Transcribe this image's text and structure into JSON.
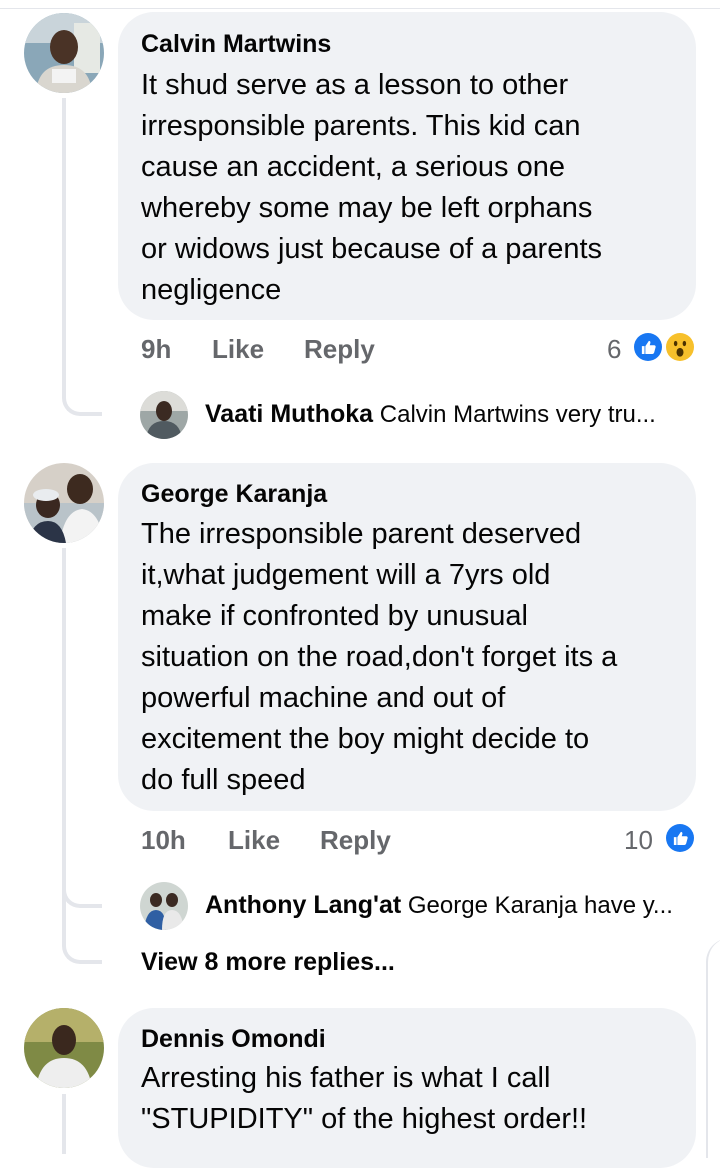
{
  "comments": [
    {
      "author": "Calvin Martwins",
      "text": "It shud serve as a lesson to other\nirresponsible parents. This kid can\ncause an accident, a serious one\nwhereby some may be left orphans\nor widows just because of a parents\nnegligence",
      "time": "9h",
      "like_label": "Like",
      "reply_label": "Reply",
      "reaction_count": "6",
      "reactions": [
        "like-icon",
        "wow-icon"
      ],
      "reply": {
        "author": "Vaati Muthoka",
        "text": "Calvin Martwins very tru..."
      }
    },
    {
      "author": "George Karanja",
      "text": "The irresponsible parent deserved\nit,what judgement will a 7yrs old\nmake if confronted by unusual\nsituation on the road,don't forget its a\npowerful machine and out of\nexcitement the boy might decide to\ndo full speed",
      "time": "10h",
      "like_label": "Like",
      "reply_label": "Reply",
      "reaction_count": "10",
      "reactions": [
        "like-icon"
      ],
      "reply": {
        "author": "Anthony Lang'at",
        "text": "George Karanja have y..."
      },
      "view_more": "View 8 more replies..."
    },
    {
      "author": "Dennis Omondi",
      "text": "Arresting his father is what I call\n\"STUPIDITY\" of the highest order!!"
    }
  ],
  "colors": {
    "bubble": "#f0f2f5",
    "meta_text": "#65676b",
    "like_blue": "#1877f2",
    "wow_yellow": "#f7c02b",
    "thread_line": "#e4e6eb"
  }
}
